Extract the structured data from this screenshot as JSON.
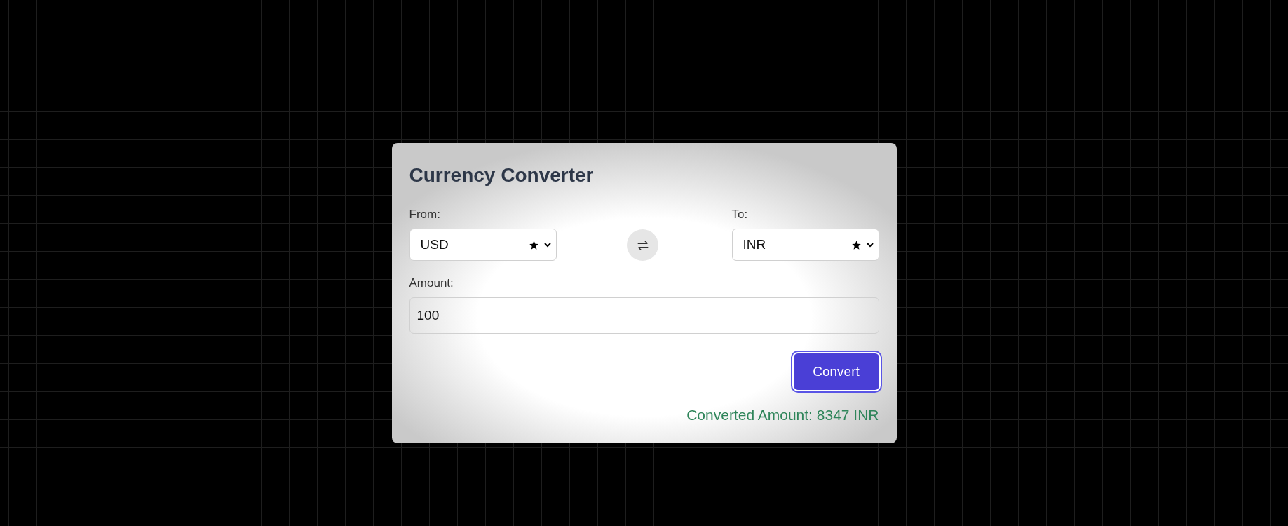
{
  "title": "Currency Converter",
  "from": {
    "label": "From:",
    "value": "USD"
  },
  "to": {
    "label": "To:",
    "value": "INR"
  },
  "amount": {
    "label": "Amount:",
    "value": "100"
  },
  "convert_button": "Convert",
  "result": "Converted Amount: 8347 INR"
}
